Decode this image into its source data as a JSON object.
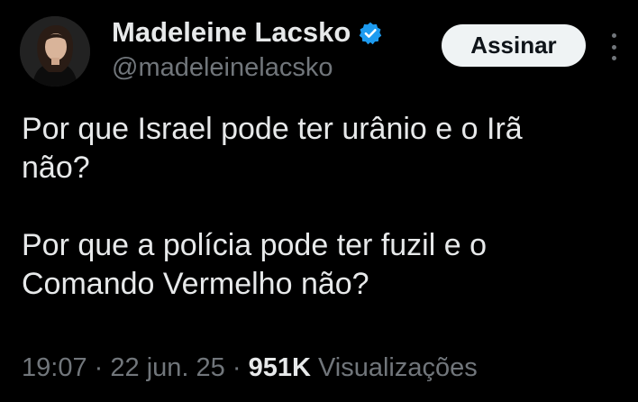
{
  "author": {
    "display_name": "Madeleine Lacsko",
    "handle": "@madeleinelacsko",
    "verified_color": "#1d9bf0"
  },
  "actions": {
    "subscribe_label": "Assinar",
    "more_icon": "more-vertical-icon"
  },
  "tweet": {
    "lines": [
      "Por que Israel pode ter urânio e o Irã",
      "não?",
      "Por que a polícia pode ter fuzil e o",
      "Comando Vermelho não?"
    ]
  },
  "meta": {
    "time": "19:07",
    "sep1": "·",
    "date": "22 jun. 25",
    "sep2": "·",
    "views_count": "951K",
    "views_label": "Visualizações"
  },
  "colors": {
    "background": "#000000",
    "primary_text": "#e7e9ea",
    "secondary_text": "#71767b",
    "button_bg": "#eff3f4"
  }
}
